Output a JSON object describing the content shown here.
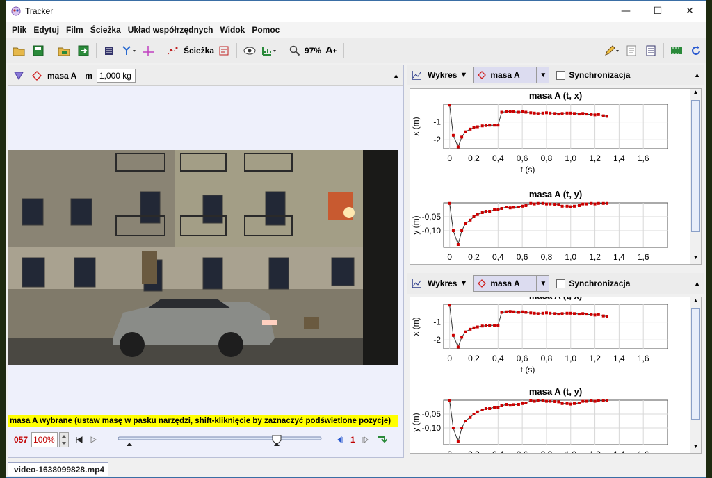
{
  "window": {
    "title": "Tracker",
    "controls": [
      "—",
      "☐",
      "✕"
    ]
  },
  "menu": [
    "Plik",
    "Edytuj",
    "Film",
    "Ścieżka",
    "Układ współrzędnych",
    "Widok",
    "Pomoc"
  ],
  "toolbar": {
    "track_label": "Ścieżka",
    "zoom": "97%"
  },
  "track_bar": {
    "name": "masa A",
    "mass_label": "m",
    "mass_value": "1,000 kg"
  },
  "status_message": "masa A wybrane (ustaw masę w pasku narzędzi, shift-kliknięcie by zaznaczyć podświetlone pozycje)",
  "player": {
    "frame": "057",
    "zoom": "100%",
    "step": "1"
  },
  "file_tab": "video-1638099828.mp4",
  "plot_panels": [
    {
      "view": "Wykres",
      "track": "masa A",
      "sync_label": "Synchronizacja"
    },
    {
      "view": "Wykres",
      "track": "masa A",
      "sync_label": "Synchronizacja"
    }
  ],
  "chart_data": [
    {
      "type": "line",
      "title": "masa A (t, x)",
      "xlabel": "t (s)",
      "ylabel": "x (m)",
      "xlim": [
        -0.05,
        1.8
      ],
      "ylim": [
        -2.5,
        0.0
      ],
      "xticks": [
        "0",
        "0,2",
        "0,4",
        "0,6",
        "0,8",
        "1,0",
        "1,2",
        "1,4",
        "1,6"
      ],
      "yticks": [
        "-1",
        "-2"
      ],
      "color": "#cc0000",
      "x": [
        0,
        0.03,
        0.07,
        0.1,
        0.13,
        0.17,
        0.2,
        0.23,
        0.27,
        0.3,
        0.33,
        0.37,
        0.4,
        0.43,
        0.47,
        0.5,
        0.53,
        0.57,
        0.6,
        0.63,
        0.67,
        0.7,
        0.73,
        0.77,
        0.8,
        0.83,
        0.87,
        0.9,
        0.93,
        0.97,
        1.0,
        1.03,
        1.07,
        1.1,
        1.13,
        1.17,
        1.2,
        1.23,
        1.27,
        1.3
      ],
      "y": [
        -0.05,
        -1.75,
        -2.4,
        -1.85,
        -1.55,
        -1.4,
        -1.32,
        -1.27,
        -1.22,
        -1.2,
        -1.18,
        -1.18,
        -1.18,
        -0.45,
        -0.42,
        -0.4,
        -0.42,
        -0.45,
        -0.42,
        -0.45,
        -0.48,
        -0.5,
        -0.52,
        -0.5,
        -0.48,
        -0.5,
        -0.52,
        -0.55,
        -0.52,
        -0.5,
        -0.5,
        -0.52,
        -0.55,
        -0.52,
        -0.55,
        -0.58,
        -0.6,
        -0.58,
        -0.65,
        -0.68
      ]
    },
    {
      "type": "line",
      "title": "masa A (t, y)",
      "xlabel": "t (s)",
      "ylabel": "y (m)",
      "xlim": [
        -0.05,
        1.8
      ],
      "ylim": [
        -0.16,
        0.0
      ],
      "xticks": [
        "0",
        "0,2",
        "0,4",
        "0,6",
        "0,8",
        "1,0",
        "1,2",
        "1,4",
        "1,6"
      ],
      "yticks": [
        "-0,05",
        "-0,10"
      ],
      "color": "#cc0000",
      "x": [
        0,
        0.03,
        0.07,
        0.1,
        0.13,
        0.17,
        0.2,
        0.23,
        0.27,
        0.3,
        0.33,
        0.37,
        0.4,
        0.43,
        0.47,
        0.5,
        0.53,
        0.57,
        0.6,
        0.63,
        0.67,
        0.7,
        0.73,
        0.77,
        0.8,
        0.83,
        0.87,
        0.9,
        0.93,
        0.97,
        1.0,
        1.03,
        1.07,
        1.1,
        1.13,
        1.17,
        1.2,
        1.23,
        1.27,
        1.3
      ],
      "y": [
        -0.002,
        -0.1,
        -0.15,
        -0.1,
        -0.075,
        -0.062,
        -0.05,
        -0.042,
        -0.035,
        -0.03,
        -0.03,
        -0.025,
        -0.025,
        -0.02,
        -0.015,
        -0.018,
        -0.016,
        -0.015,
        -0.012,
        -0.01,
        -0.002,
        -0.004,
        -0.002,
        -0.002,
        -0.004,
        -0.004,
        -0.005,
        -0.006,
        -0.012,
        -0.012,
        -0.014,
        -0.012,
        -0.01,
        -0.004,
        -0.004,
        -0.002,
        -0.004,
        -0.002,
        -0.002,
        -0.002
      ]
    }
  ]
}
